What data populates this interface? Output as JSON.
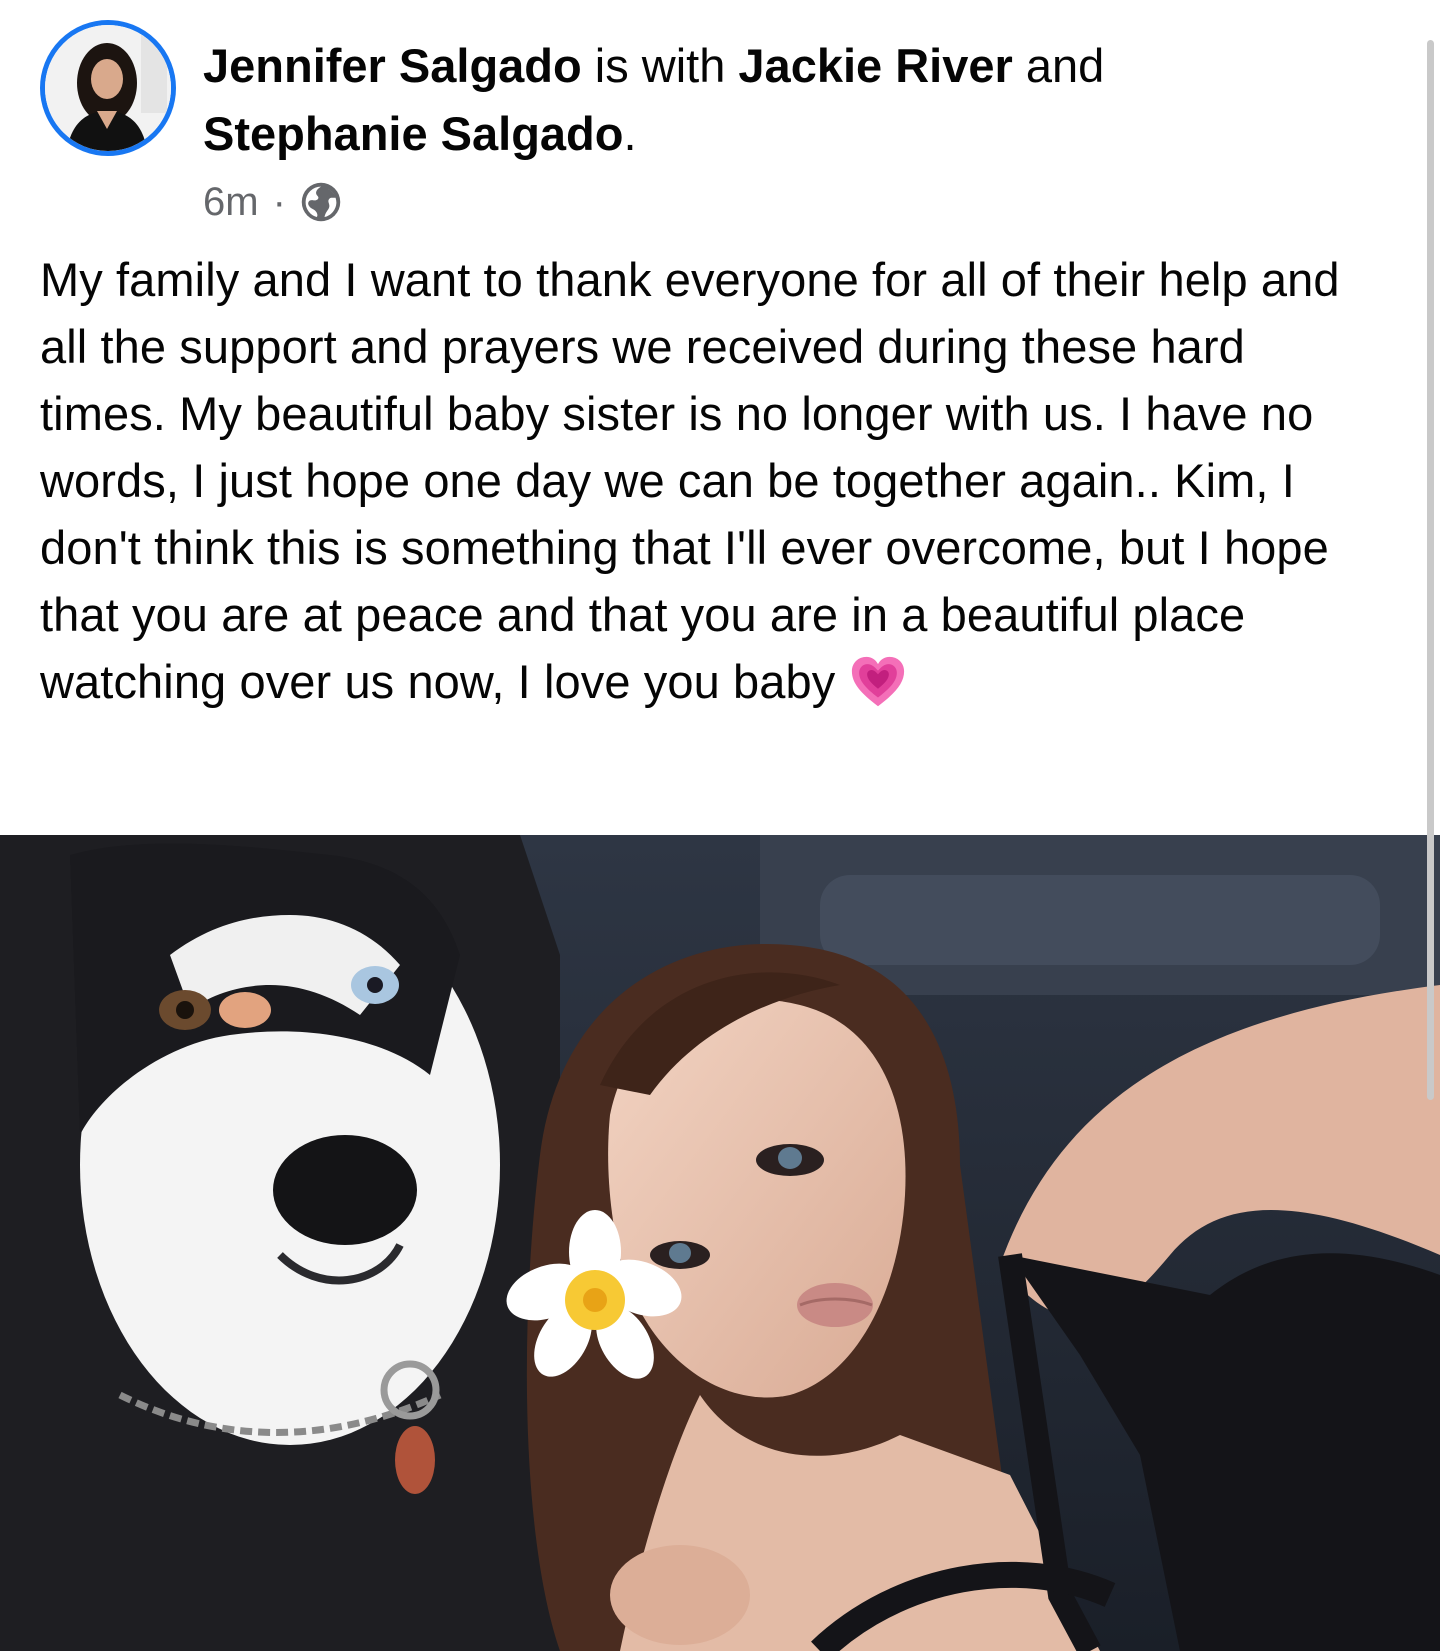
{
  "post": {
    "author": "Jennifer Salgado",
    "connector_with": " is with ",
    "tagged_1": "Jackie River",
    "connector_and": " and ",
    "tagged_2": "Stephanie Salgado",
    "period": ".",
    "timestamp": "6m",
    "separator": "·",
    "privacy_icon": "globe-icon",
    "body": "My family and I want to thank everyone for all of their help and all the support and prayers we received during these hard times. My beautiful baby sister is no longer with us. I have no words, I just hope one day we can be together again.. Kim, I don't think this is something that I'll ever overcome, but I hope that you are at peace and that you are in a beautiful place watching over us now, I love you baby",
    "emoji": "growing-heart-icon"
  },
  "colors": {
    "avatar_ring": "#1877f2",
    "meta_text": "#65676b",
    "text": "#050505"
  }
}
